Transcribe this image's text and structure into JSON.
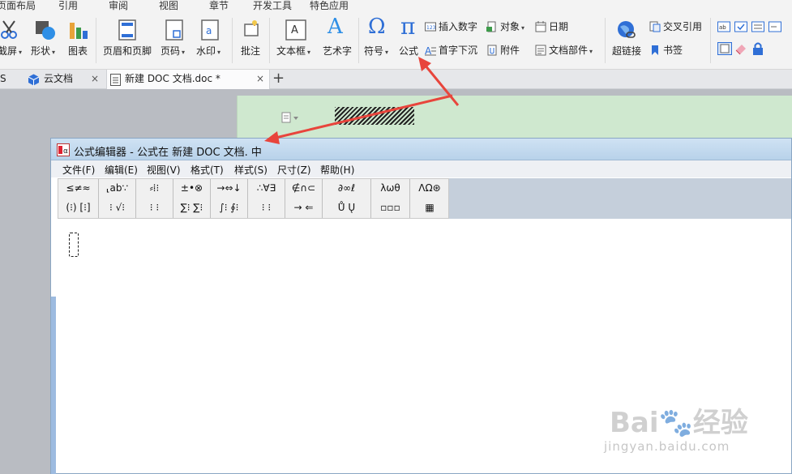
{
  "menu_tabs": [
    "页面布局",
    "引用",
    "审阅",
    "视图",
    "章节",
    "开发工具",
    "特色应用"
  ],
  "ribbon": {
    "screenshot_label": "截屏",
    "shapes_label": "形状",
    "chart_label": "图表",
    "header_footer_label": "页眉和页脚",
    "page_number_label": "页码",
    "watermark_label": "水印",
    "comment_label": "批注",
    "textbox_label": "文本框",
    "wordart_label": "艺术字",
    "symbol_label": "符号",
    "equation_label": "公式",
    "insert_number_label": "插入数字",
    "drop_cap_label": "首字下沉",
    "object_label": "对象",
    "attachment_label": "附件",
    "date_label": "日期",
    "doc_parts_label": "文档部件",
    "hyperlink_label": "超链接",
    "cross_ref_label": "交叉引用",
    "bookmark_label": "书签",
    "omega_glyph": "Ω",
    "pi_glyph": "π",
    "wordart_glyph": "A",
    "dropdown_glyph": "▾"
  },
  "doc_tabs": {
    "partial_label": "S",
    "cloud_label": "云文档",
    "doc_label": "新建 DOC 文档.doc *",
    "close_glyph": "×",
    "new_tab_glyph": "+"
  },
  "equation_editor": {
    "title": "公式编辑器 - 公式在 新建 DOC 文档. 中",
    "menu": [
      "文件(F)",
      "编辑(E)",
      "视图(V)",
      "格式(T)",
      "样式(S)",
      "尺寸(Z)",
      "帮助(H)"
    ],
    "palette_row1": [
      "≤≠≈",
      "⸤ab∵",
      "⸗⁞⁝",
      "±•⊗",
      "→⇔↓",
      "∴∀∃",
      "∉∩⊂",
      "∂∞ℓ",
      "λωθ",
      "ΛΩ⊛"
    ],
    "palette_row2": [
      "(⁝) [⁝]",
      "⁝ √⁝",
      "⁝ ⁝",
      "∑⁝ ∑⁝",
      "∫⁝ ∮⁝",
      "⁝ ⁝",
      "→ ⇐",
      "Ů Ų",
      "▫▫▫",
      "▦"
    ]
  },
  "watermark": {
    "brand": "Bai🐾经验",
    "url": "jingyan.baidu.com"
  },
  "colors": {
    "ribbon_bg": "#f3f3f3",
    "doc_page_bg": "#cfe8cf",
    "title_bar": "#b8d2ea",
    "arrow": "#e8453c",
    "accent_blue": "#2f6fd6"
  }
}
